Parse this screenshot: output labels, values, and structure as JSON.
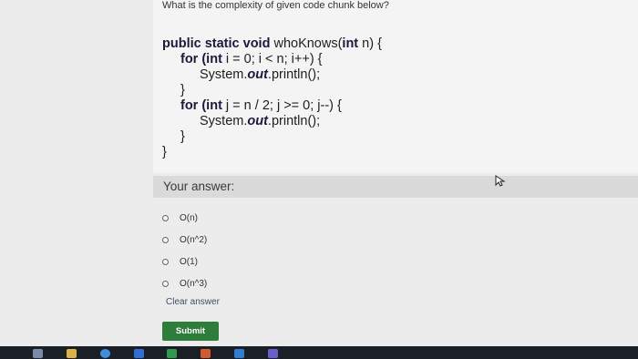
{
  "question": "What is the complexity of given code chunk below?",
  "code": {
    "line1": {
      "kw": "public static void",
      "rest": " whoKnows(",
      "kw2": "int",
      "end": " n) {"
    },
    "line2": {
      "kw": "for (int",
      "rest": " i = 0; i < n; i++) {"
    },
    "line3": {
      "pre": "System.",
      "obj": "out",
      "post": ".println();"
    },
    "line4": "}",
    "line5": {
      "kw": "for (int",
      "rest": " j = n / 2; j >= 0; j--) {"
    },
    "line6": {
      "pre": "System.",
      "obj": "out",
      "post": ".println();"
    },
    "line7": "}",
    "line8": "}"
  },
  "answer_label": "Your answer:",
  "options": [
    "O(n)",
    "O(n^2)",
    "O(1)",
    "O(n^3)"
  ],
  "clear_label": "Clear answer",
  "submit_label": "Submit",
  "colors": {
    "submit": "#2e7d3a",
    "taskbar": "#1b1f26"
  },
  "taskbar_icons": [
    "windows-start-icon",
    "file-explorer-icon",
    "browser-icon",
    "word-icon",
    "excel-icon",
    "powerpoint-icon",
    "outlook-icon",
    "teams-icon"
  ]
}
